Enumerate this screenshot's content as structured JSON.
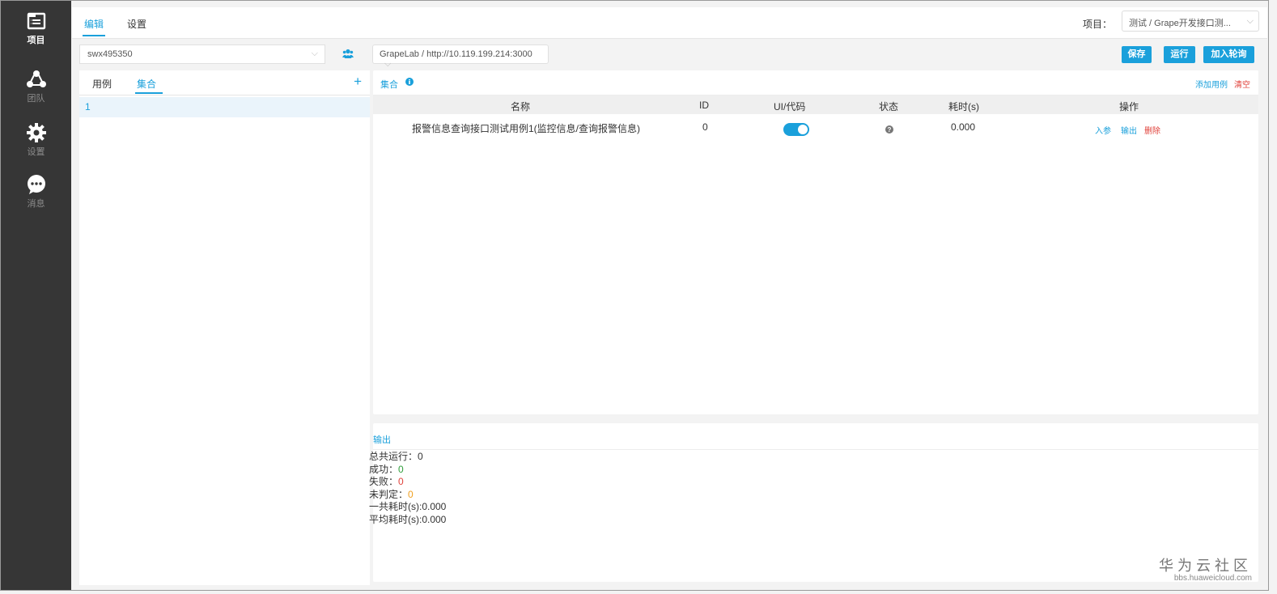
{
  "sidebar": {
    "items": [
      {
        "label": "项目",
        "icon": "project-icon",
        "active": true
      },
      {
        "label": "团队",
        "icon": "team-icon",
        "active": false
      },
      {
        "label": "设置",
        "icon": "gear-icon",
        "active": false
      },
      {
        "label": "消息",
        "icon": "message-icon",
        "active": false
      }
    ]
  },
  "topbar": {
    "tabs": [
      {
        "label": "编辑",
        "active": true
      },
      {
        "label": "设置",
        "active": false
      }
    ],
    "project_label": "项目：",
    "project_value": "测试 / Grape开发接口测..."
  },
  "toolbar": {
    "user_value": "swx495350",
    "env_value": "GrapeLab / http://10.119.199.214:3000",
    "buttons": {
      "save": "保存",
      "run": "运行",
      "add_poll": "加入轮询"
    }
  },
  "left_panel": {
    "tabs": [
      {
        "label": "用例",
        "active": false
      },
      {
        "label": "集合",
        "active": true
      }
    ],
    "plus": "+",
    "items": [
      "1"
    ]
  },
  "collection": {
    "title": "集合",
    "add_case": "添加用例",
    "clear": "清空",
    "columns": [
      "名称",
      "ID",
      "UI/代码",
      "状态",
      "耗时(s)",
      "操作"
    ],
    "rows": [
      {
        "name": "报警信息查询接口测试用例1(监控信息/查询报警信息)",
        "id": "0",
        "ui_code_on": true,
        "time": "0.000",
        "actions": {
          "input": "入参",
          "output": "输出",
          "delete": "删除"
        }
      }
    ]
  },
  "output": {
    "title": "输出",
    "total_label": "总共运行：",
    "total": "0",
    "success_label": "成功：",
    "success": "0",
    "fail_label": "失败：",
    "fail": "0",
    "undetermined_label": "未判定：",
    "undetermined": "0",
    "total_time": "一共耗时(s):0.000",
    "avg_time": "平均耗时(s):0.000"
  },
  "watermark": {
    "title": "华为云社区",
    "url": "bbs.huaweicloud.com"
  },
  "colors": {
    "accent": "#1aa0db",
    "danger": "#e0413a",
    "success": "#2e9e3a",
    "warning": "#f0a020",
    "sidebar": "#363636"
  }
}
